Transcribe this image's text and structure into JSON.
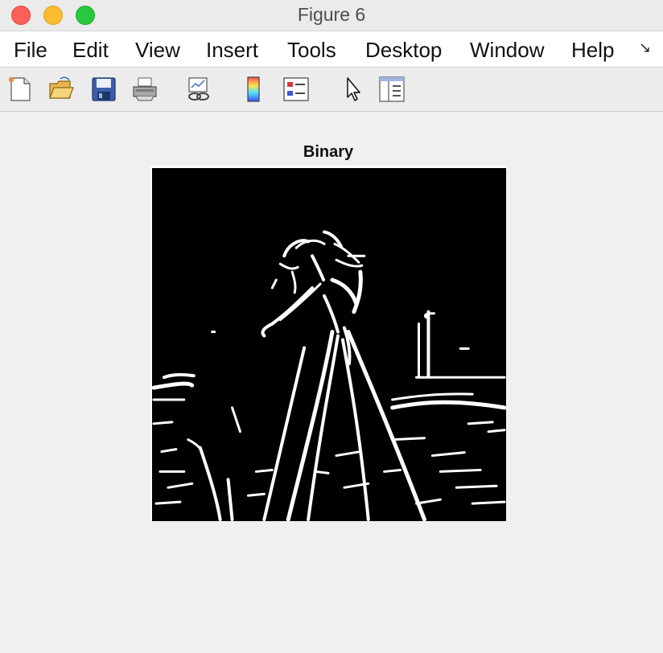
{
  "window": {
    "title": "Figure 6",
    "buttons": [
      "close",
      "minimize",
      "zoom"
    ]
  },
  "menubar": {
    "items": [
      "File",
      "Edit",
      "View",
      "Insert",
      "Tools",
      "Desktop",
      "Window",
      "Help"
    ],
    "overflow_icon": "menu-overflow-arrow-icon"
  },
  "toolbar": {
    "icons": [
      "new-figure-icon",
      "open-file-icon",
      "save-icon",
      "print-icon",
      "link-plot-icon",
      "insert-colorbar-icon",
      "insert-legend-icon",
      "edit-plot-pointer-icon",
      "show-plot-tools-icon"
    ]
  },
  "plot": {
    "title": "Binary",
    "image_description_colors": {
      "background": "#000000",
      "foreground": "#ffffff"
    }
  }
}
